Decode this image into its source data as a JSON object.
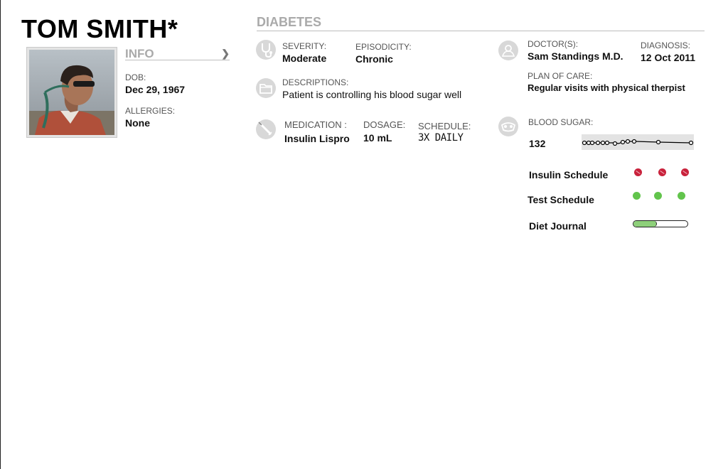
{
  "patient": {
    "name": "TOM SMITH*",
    "info_title": "INFO",
    "dob_label": "DOB:",
    "dob": "Dec 29, 1967",
    "allergies_label": "ALLERGIES:",
    "allergies": "None"
  },
  "condition": {
    "title": "DIABETES",
    "severity_label": "SEVERITY:",
    "severity": "Moderate",
    "episodicity_label": "EPISODICITY:",
    "episodicity": "Chronic",
    "descriptions_label": "DESCRIPTIONS:",
    "description": "Patient is controlling his blood sugar well",
    "medication_label": "MEDICATION :",
    "medication": "Insulin Lispro",
    "dosage_label": "DOSAGE:",
    "dosage": "10 mL",
    "schedule_label": "SCHEDULE:",
    "schedule": "3X DAILY",
    "doctors_label": "DOCTOR(S):",
    "doctor": "Sam Standings M.D.",
    "diagnosis_label": "DIAGNOSIS:",
    "diagnosis": "12 Oct 2011",
    "plan_label": "PLAN OF CARE:",
    "plan": "Regular visits with physical therpist",
    "blood_sugar_label": "BLOOD SUGAR:",
    "blood_sugar": "132"
  },
  "tracking": {
    "insulin_label": "Insulin Schedule",
    "test_label": "Test Schedule",
    "diet_label": "Diet Journal",
    "insulin_doses": 3,
    "tests": 3,
    "diet_progress": 0.42
  },
  "colors": {
    "accent_gray": "#aaaaaa",
    "insulin_dot": "#c9223c",
    "test_dot": "#62c44c",
    "diet_fill": "#8ed07a"
  }
}
